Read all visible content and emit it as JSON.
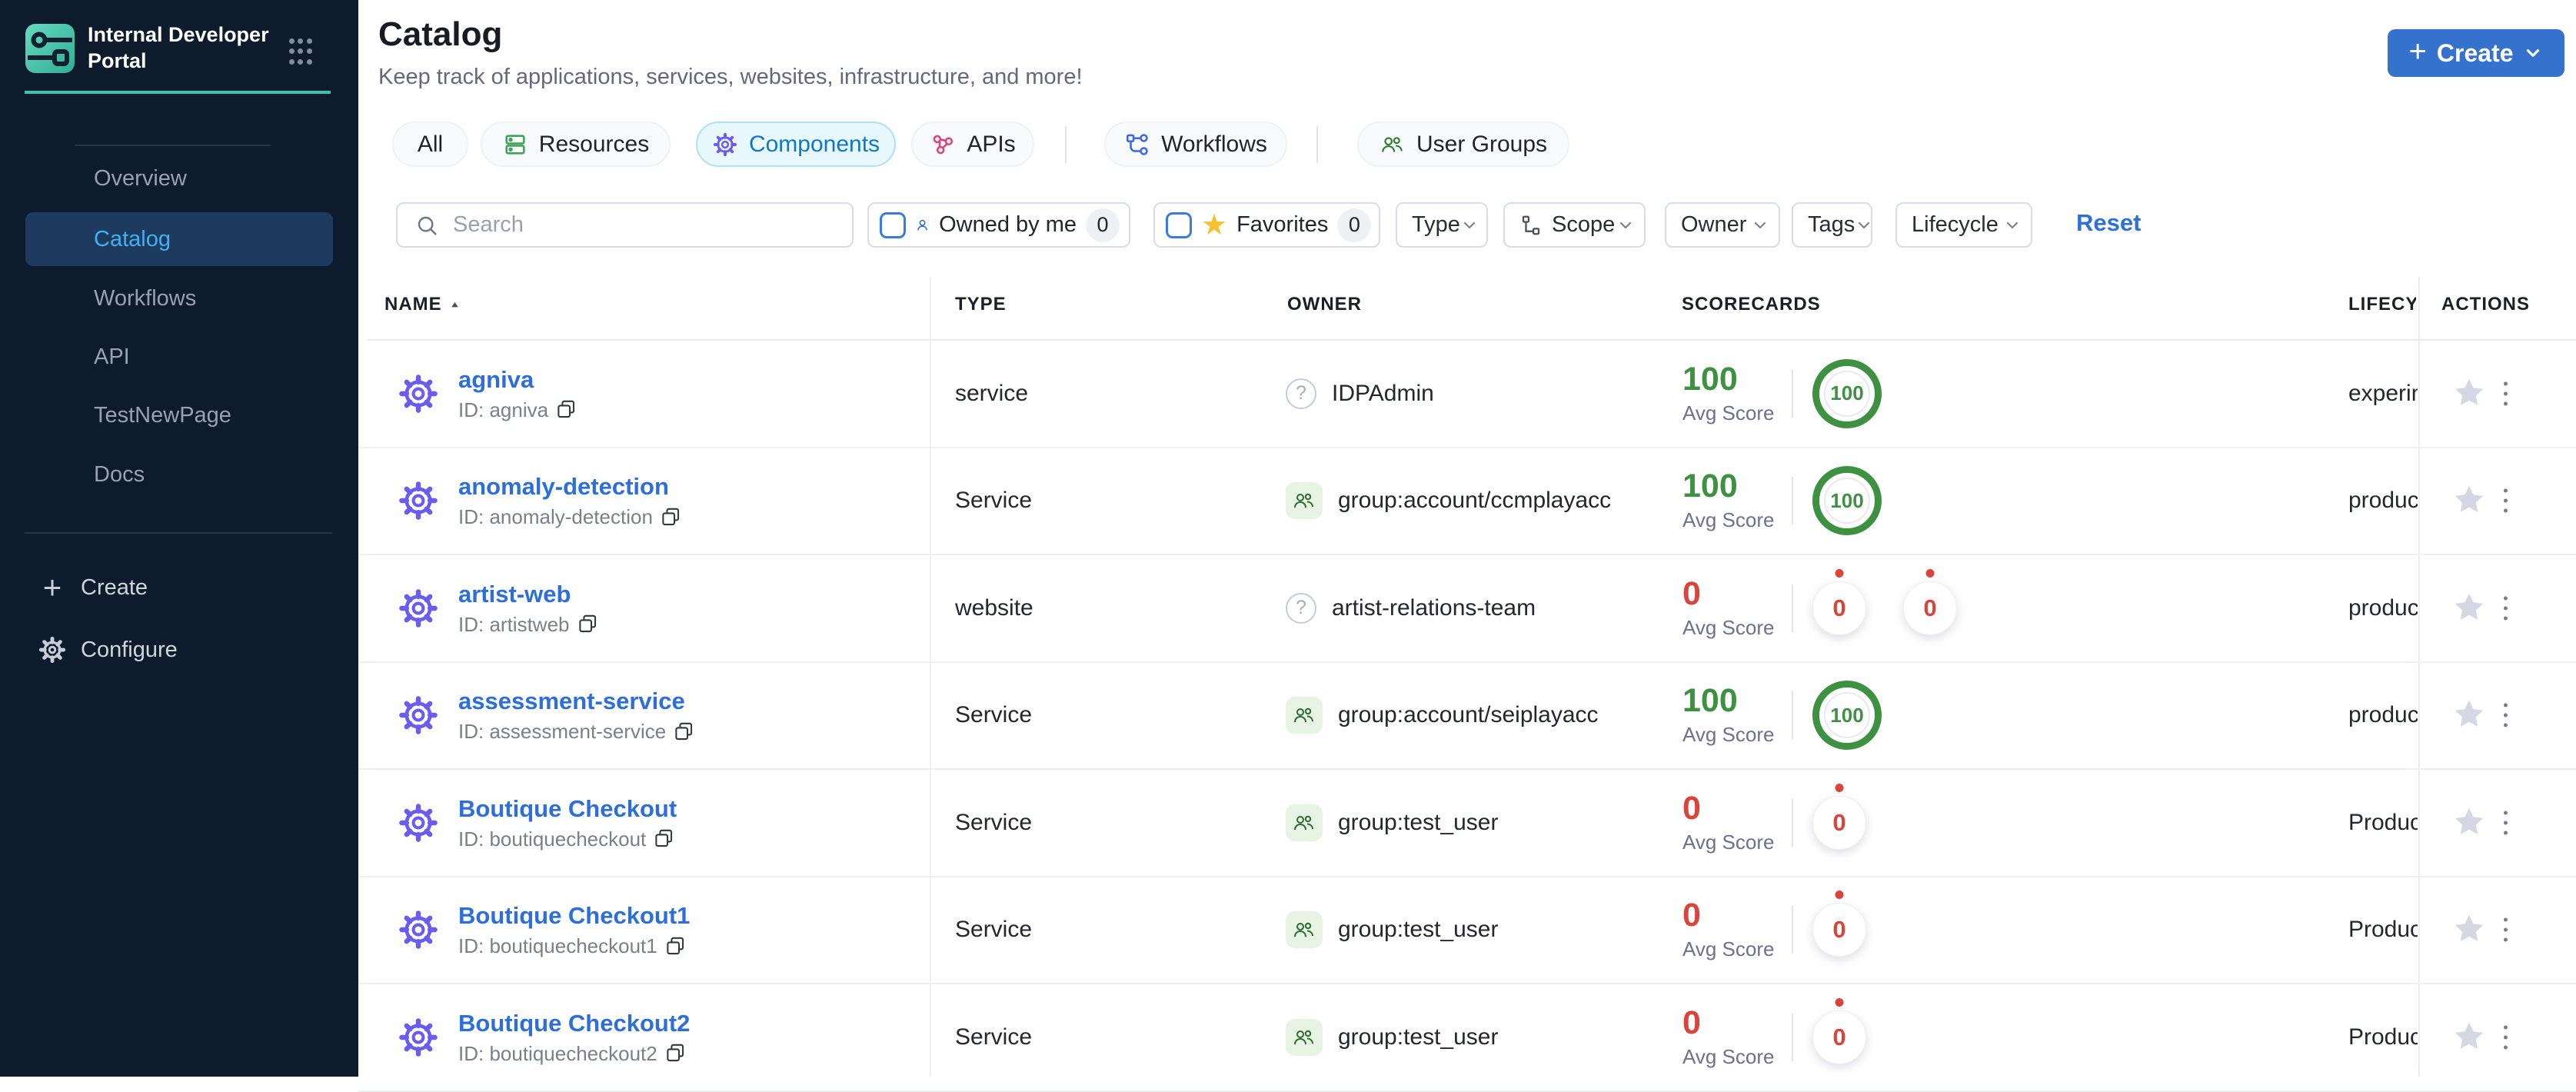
{
  "sidebar": {
    "title": "Internal Developer Portal",
    "nav": [
      {
        "label": "Overview",
        "active": false
      },
      {
        "label": "Catalog",
        "active": true
      },
      {
        "label": "Workflows",
        "active": false
      },
      {
        "label": "API",
        "active": false
      },
      {
        "label": "TestNewPage",
        "active": false
      },
      {
        "label": "Docs",
        "active": false
      }
    ],
    "create_label": "Create",
    "configure_label": "Configure"
  },
  "header": {
    "title": "Catalog",
    "subtitle": "Keep track of applications, services, websites, infrastructure, and more!",
    "create_button": "Create"
  },
  "tabs": [
    {
      "label": "All",
      "icon": null,
      "active": false
    },
    {
      "label": "Resources",
      "icon": "resources",
      "active": false
    },
    {
      "label": "Components",
      "icon": "components",
      "active": true
    },
    {
      "label": "APIs",
      "icon": "apis",
      "active": false
    },
    {
      "label": "Workflows",
      "icon": "workflows",
      "active": false
    },
    {
      "label": "User Groups",
      "icon": "user-groups",
      "active": false
    }
  ],
  "filters": {
    "search_placeholder": "Search",
    "owned_by_me": {
      "label": "Owned by me",
      "count": "0"
    },
    "favorites": {
      "label": "Favorites",
      "count": "0"
    },
    "dropdowns": [
      {
        "label": "Type",
        "icon": null
      },
      {
        "label": "Scope",
        "icon": "scope"
      },
      {
        "label": "Owner",
        "icon": null
      },
      {
        "label": "Tags",
        "icon": null
      },
      {
        "label": "Lifecycle",
        "icon": null
      }
    ],
    "reset_label": "Reset"
  },
  "table": {
    "columns": [
      "NAME",
      "TYPE",
      "OWNER",
      "SCORECARDS",
      "LIFECYCLE",
      "ACTIONS"
    ],
    "avg_score_label": "Avg Score",
    "rows": [
      {
        "name": "agniva",
        "id": "ID: agniva",
        "type": "service",
        "owner": {
          "kind": "user",
          "label": "IDPAdmin"
        },
        "score": {
          "value": "100",
          "tone": "green"
        },
        "badges": [
          {
            "value": "100",
            "tone": "green"
          }
        ],
        "lifecycle": "experimental"
      },
      {
        "name": "anomaly-detection",
        "id": "ID: anomaly-detection",
        "type": "Service",
        "owner": {
          "kind": "group",
          "label": "group:account/ccmplayacc"
        },
        "score": {
          "value": "100",
          "tone": "green"
        },
        "badges": [
          {
            "value": "100",
            "tone": "green"
          }
        ],
        "lifecycle": "production"
      },
      {
        "name": "artist-web",
        "id": "ID: artistweb",
        "type": "website",
        "owner": {
          "kind": "user",
          "label": "artist-relations-team"
        },
        "score": {
          "value": "0",
          "tone": "red"
        },
        "badges": [
          {
            "value": "0",
            "tone": "red"
          },
          {
            "value": "0",
            "tone": "red"
          }
        ],
        "lifecycle": "production"
      },
      {
        "name": "assessment-service",
        "id": "ID: assessment-service",
        "type": "Service",
        "owner": {
          "kind": "group",
          "label": "group:account/seiplayacc"
        },
        "score": {
          "value": "100",
          "tone": "green"
        },
        "badges": [
          {
            "value": "100",
            "tone": "green"
          }
        ],
        "lifecycle": "production"
      },
      {
        "name": "Boutique Checkout",
        "id": "ID: boutiquecheckout",
        "type": "Service",
        "owner": {
          "kind": "group",
          "label": "group:test_user"
        },
        "score": {
          "value": "0",
          "tone": "red"
        },
        "badges": [
          {
            "value": "0",
            "tone": "red"
          }
        ],
        "lifecycle": "Production"
      },
      {
        "name": "Boutique Checkout1",
        "id": "ID: boutiquecheckout1",
        "type": "Service",
        "owner": {
          "kind": "group",
          "label": "group:test_user"
        },
        "score": {
          "value": "0",
          "tone": "red"
        },
        "badges": [
          {
            "value": "0",
            "tone": "red"
          }
        ],
        "lifecycle": "Production"
      },
      {
        "name": "Boutique Checkout2",
        "id": "ID: boutiquecheckout2",
        "type": "Service",
        "owner": {
          "kind": "group",
          "label": "group:test_user"
        },
        "score": {
          "value": "0",
          "tone": "red"
        },
        "badges": [
          {
            "value": "0",
            "tone": "red"
          }
        ],
        "lifecycle": "Production"
      }
    ]
  },
  "colors": {
    "sidebar_bg": "#0e1b2c",
    "active_nav_bg": "#1d3a5f",
    "active_nav_text": "#41b1f3",
    "teal": "#3fc2a9",
    "primary_blue": "#3572cd",
    "link_blue": "#2c6edb",
    "green": "#3f9142",
    "red": "#d9453c",
    "indigo": "#6c5bf0",
    "pink": "#dc4379",
    "tab_active_bg": "#e9f7fe",
    "tab_active_text": "#0c78c8"
  }
}
